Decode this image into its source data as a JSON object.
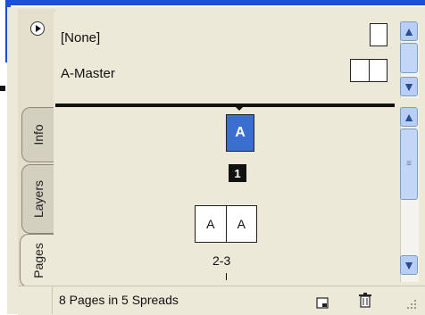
{
  "panel": {
    "tabs": [
      {
        "label": "Info"
      },
      {
        "label": "Layers"
      },
      {
        "label": "Pages"
      }
    ],
    "masters": {
      "none_label": "[None]",
      "master_label": "A-Master"
    },
    "pages": {
      "page1_prefix": "A",
      "page1_number": "1",
      "spread_left_prefix": "A",
      "spread_right_prefix": "A",
      "spread_label": "2-3"
    },
    "status": {
      "text": "8 Pages in 5 Spreads"
    },
    "icons": [
      "panel-menu-icon",
      "single-page-icon",
      "facing-pages-icon",
      "new-page-icon",
      "trash-icon",
      "resize-grip-icon"
    ],
    "colors": {
      "page_blue": "#3b6fcf",
      "panel_bg": "#ece9d8",
      "scrollbar_blue": "#b9cef6"
    }
  }
}
